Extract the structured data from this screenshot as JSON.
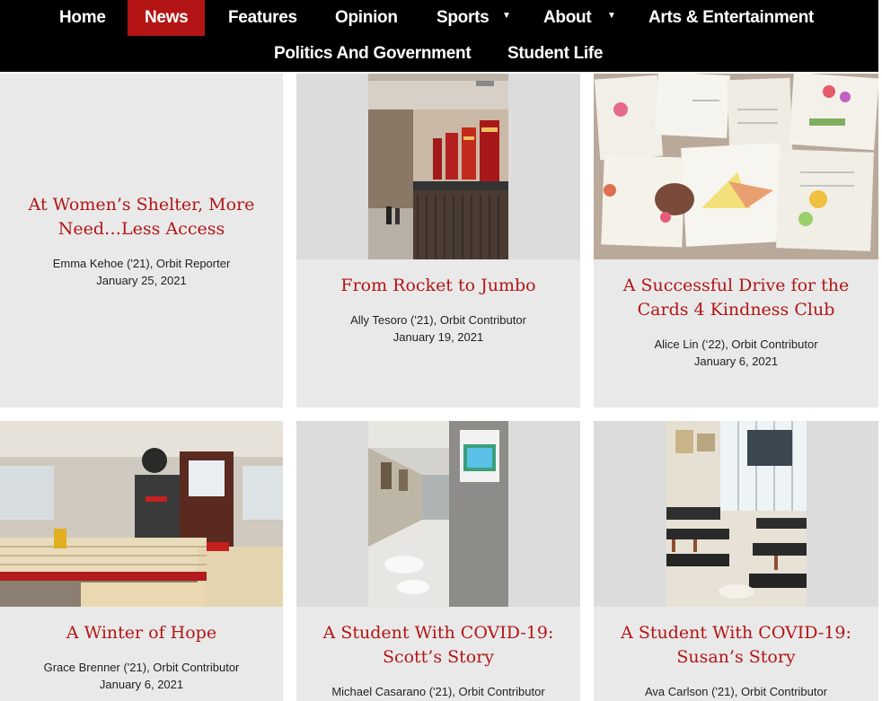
{
  "nav": {
    "items": [
      {
        "label": "Home"
      },
      {
        "label": "News",
        "active": true
      },
      {
        "label": "Features"
      },
      {
        "label": "Opinion"
      },
      {
        "label": "Sports",
        "has_dropdown": true
      },
      {
        "label": "About",
        "has_dropdown": true
      },
      {
        "label": "Arts & Entertainment"
      },
      {
        "label": "Politics And Government"
      },
      {
        "label": "Student Life"
      }
    ],
    "dropdown_glyph": "▼"
  },
  "colors": {
    "nav_bg": "#000000",
    "accent": "#b31515",
    "card_bg": "#e9e9e9",
    "title": "#b31515"
  },
  "articles": [
    {
      "title_lines": [
        "At Women’s Shelter, More",
        "Need…Less Access"
      ],
      "byline": "Emma Kehoe ('21), Orbit Reporter",
      "date": "January 25, 2021",
      "image": "none"
    },
    {
      "title_lines": [
        "From Rocket to Jumbo"
      ],
      "byline": "Ally Tesoro ('21), Orbit Contributor",
      "date": "January 19, 2021",
      "image": "school-hallway-banners"
    },
    {
      "title_lines": [
        "A Successful Drive for the",
        "Cards 4 Kindness Club"
      ],
      "byline": "Alice Lin (‘22), Orbit Contributor",
      "date": "January 6, 2021",
      "image": "handmade-cards"
    },
    {
      "title_lines": [
        "A Winter of Hope"
      ],
      "byline": "Grace Brenner ('21), Orbit Contributor",
      "date": "January 6, 2021",
      "image": "woodworking-garage"
    },
    {
      "title_lines": [
        "A Student With COVID-19:",
        "Scott’s Story"
      ],
      "byline": "Michael Casarano ('21), Orbit Contributor",
      "date": "",
      "image": "empty-school-corridor"
    },
    {
      "title_lines": [
        "A Student With COVID-19:",
        "Susan’s Story"
      ],
      "byline": "Ava Carlson ('21), Orbit Contributor",
      "date": "",
      "image": "science-classroom"
    }
  ]
}
